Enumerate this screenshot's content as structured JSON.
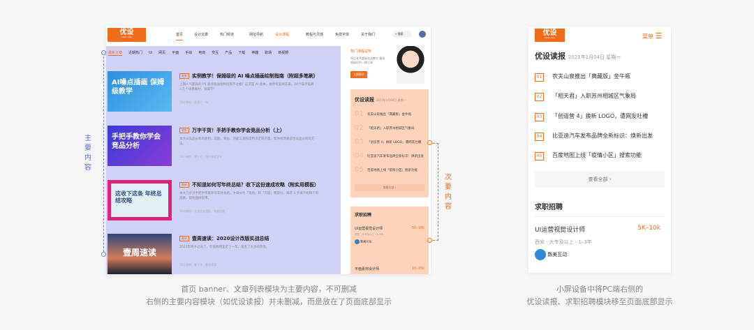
{
  "pc": {
    "logo": "优设",
    "logo_sub": "uisdc.com",
    "nav": [
      "首页",
      "设计文章",
      "热门频道",
      "网址导航",
      "设计课程",
      "教程与灵感",
      "免费字体",
      "关于我们"
    ],
    "search": "搜索",
    "tabs": [
      "最新文章",
      "近期热门",
      "UI",
      "网页",
      "平面",
      "手绘",
      "电商",
      "交互",
      "产品",
      "下载",
      "神器",
      "职场",
      "新视野"
    ],
    "articles": [
      {
        "thumb": "AI噪点插画 保姆级教学",
        "tag": "最新",
        "title": "实例教学！保姆级的 AI 噪点插画绘制指南（附超多笔刷）",
        "desc": "上期人气超高的 PS 噪点插画绘制指南不过瘾？这次是 AI 版本，依然有案例实操，24个噪点笔刷+几个场景素材，快来学！",
        "meta": [
          "56分钟前",
          "黑雨兰",
          "AI"
        ]
      },
      {
        "thumb": "手把手教你学会 竞品分析",
        "tag": "最新",
        "title": "万字干货！手把手教你学会竞品分析（上）",
        "desc": "本文从竞品分析的原则、前期、目标、功能工具和常用决定等方面，帮你找到最适合竞品分析的方法。",
        "meta": [
          "56分钟前",
          "做少七",
          "用户体验设计"
        ]
      },
      {
        "thumb": "这收下这条 年终总结攻略",
        "tag": "最新",
        "title": "不知道如何写年终总结？收下这份速成攻略（附实用模板）",
        "desc": "本文几乎涉手把手带着你写年终总结，文章分为「现场」和「内容」两部分，揭开 5 步来介绍每个的思路，帮你直接套用。",
        "meta": [
          "56分钟前",
          "优设设计团队",
          "年度总结"
        ]
      },
      {
        "thumb": "壹周速读",
        "tag": "最新",
        "title": "壹周速读：2020设计改版实战总结",
        "desc": "2020年终于过去了，在低情绪里走了一年，发生了太多的改变。",
        "meta": [
          "56分钟前",
          "集子木",
          "壹周速读"
        ]
      }
    ],
    "promo": {
      "title": "热门课程试听",
      "desc": "网红老师超级实战教学 精选超级好的一期订阅",
      "button": "立即报名"
    },
    "daily": {
      "title": "优设读报",
      "date": "2021年1月04日 星期一",
      "items": [
        {
          "num": "01",
          "text": "农夫山泉推出「典藏版」金牛瓶"
        },
        {
          "num": "02",
          "text": "「相天君」入职苏州相城区气象局"
        },
        {
          "num": "03",
          "text": "「创造营 4」换新 LOGO，遭网友吐槽"
        },
        {
          "num": "04",
          "text": "比亚迪汽车发布品牌全新标识：焕新出发"
        },
        {
          "num": "05",
          "text": "百度地图上线「疫情小区」搜索功能"
        }
      ],
      "more": "查看全部 ›"
    },
    "jobs": {
      "title": "求职招聘",
      "items": [
        {
          "title": "UI运营视觉设计师",
          "salary": "5K–10k",
          "info": "西安 · 大专及以上 · 1–3年",
          "company": "数美互动"
        },
        {
          "title": "平面素材设计师",
          "salary": "10–15k"
        }
      ]
    }
  },
  "annot": {
    "primary": "主要内容",
    "secondary": "次要内容"
  },
  "mobile": {
    "logo": "优设",
    "logo_sub": "uisdc.com",
    "menu": "菜单",
    "daily": {
      "title": "优设读报",
      "date": "2021年1月04日 星期一",
      "items": [
        {
          "num": "01",
          "text": "农夫山泉推出「典藏版」金牛瓶"
        },
        {
          "num": "02",
          "text": "「相天君」入职苏州相城区气象局"
        },
        {
          "num": "03",
          "text": "「创造营 4」换新 LOGO，遭网友吐槽"
        },
        {
          "num": "04",
          "text": "比亚迪汽车发布品牌全新标识：焕新出发"
        },
        {
          "num": "05",
          "text": "百度地图上线「疫情小区」搜索功能"
        }
      ],
      "more": "查看全部 ›"
    },
    "jobs": {
      "title": "求职招聘",
      "item": {
        "title": "UI运营视觉设计师",
        "salary": "5K–10k",
        "info": "西安 · 大专及以上 · 1–3年",
        "company": "数美互动"
      }
    }
  },
  "captions": {
    "left": [
      "首页 banner、文章列表模块为主要内容，不可删减",
      "右侧的主要内容模块（如优设读报）并未删减，而是放在了页面底部显示"
    ],
    "right": [
      "小屏设备中将PC端右侧的",
      "优设读报、求职招聘模块移至页面底部显示"
    ]
  },
  "colors": {
    "brand": "#f26a1b",
    "primary_overlay": "#cfd2f6",
    "secondary_overlay": "#fdd3bc",
    "annot_blue": "#5b6fd6"
  }
}
